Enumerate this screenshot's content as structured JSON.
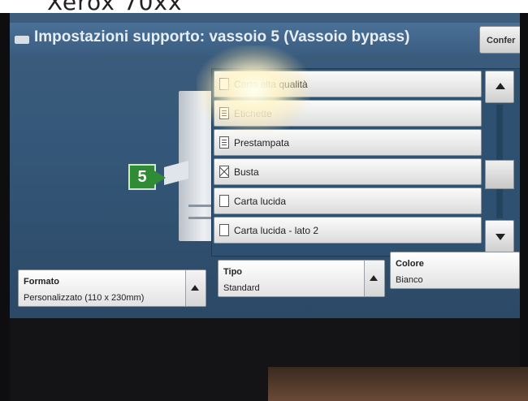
{
  "device": {
    "model": "Xerox 70xx"
  },
  "header": {
    "title": "Impostazioni supporto: vassoio 5 (Vassoio bypass)",
    "confirm_label": "Confer"
  },
  "printer": {
    "tray_number": "5"
  },
  "paper_types": {
    "items": [
      {
        "label": "Carta alta qualità",
        "icon": "paper-icon"
      },
      {
        "label": "Etichette",
        "icon": "lined-paper-icon"
      },
      {
        "label": "Prestampata",
        "icon": "lined-paper-icon"
      },
      {
        "label": "Busta",
        "icon": "envelope-icon"
      },
      {
        "label": "Carta lucida",
        "icon": "paper-icon"
      },
      {
        "label": "Carta lucida - lato 2",
        "icon": "paper-icon"
      }
    ]
  },
  "fields": {
    "formato": {
      "label": "Formato",
      "value": "Personalizzato (110 x 230mm)"
    },
    "tipo": {
      "label": "Tipo",
      "value": "Standard"
    },
    "colore": {
      "label": "Colore",
      "value": "Bianco"
    }
  },
  "colors": {
    "screen": "#35587a",
    "titlebar": "#4b7197",
    "tray_badge": "#2f8c34"
  }
}
